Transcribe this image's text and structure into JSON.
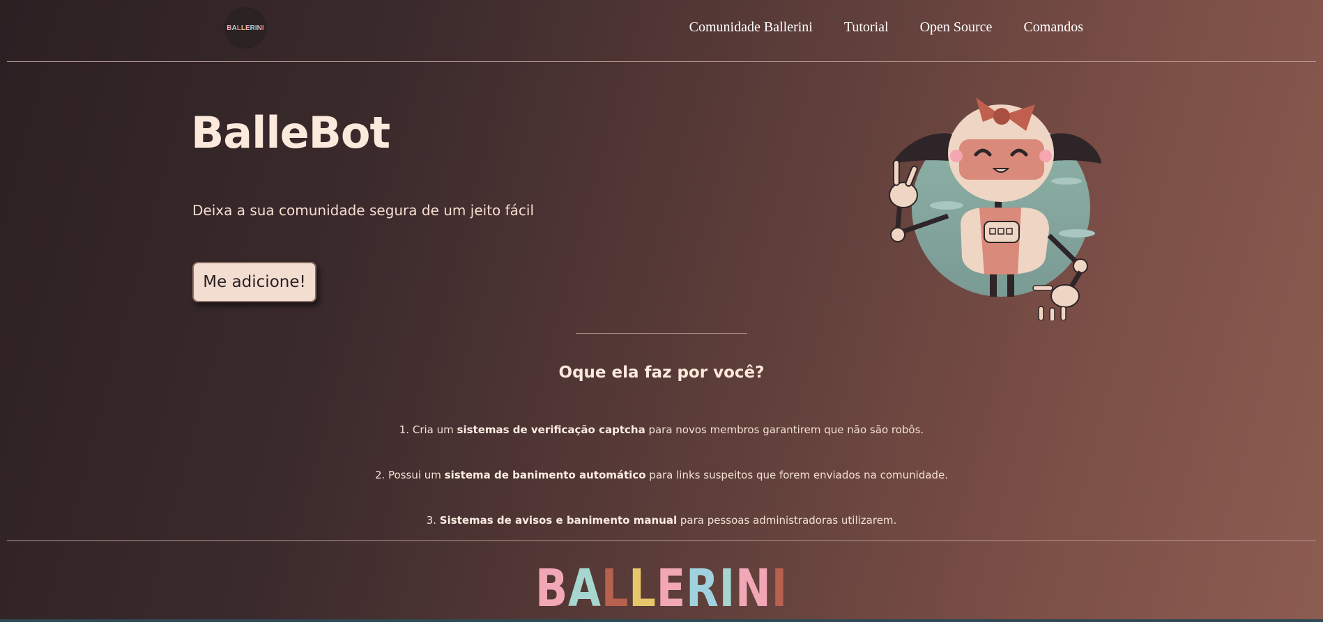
{
  "nav": {
    "logo_text": "BALLERINI",
    "links": [
      {
        "label": "Comunidade Ballerini"
      },
      {
        "label": "Tutorial"
      },
      {
        "label": "Open Source"
      },
      {
        "label": "Comandos"
      }
    ]
  },
  "hero": {
    "title": "BalleBot",
    "subtitle": "Deixa a sua comunidade segura de um jeito fácil",
    "button_label": "Me adicione!"
  },
  "features_section": {
    "title": "Oque ela faz por você?",
    "items": [
      {
        "prefix": "1. Cria um ",
        "bold": "sistemas de verificação captcha",
        "suffix": " para novos membros garantirem que não são robôs."
      },
      {
        "prefix": "2. Possui um ",
        "bold": "sistema de banimento automático",
        "suffix": " para links suspeitos que forem enviados na comunidade."
      },
      {
        "prefix": "3. ",
        "bold": "Sistemas de avisos e banimento manual",
        "suffix": " para pessoas administradoras utilizarem."
      }
    ]
  },
  "footer": {
    "logo_letters": [
      {
        "char": "B",
        "color": "#f2a7b6"
      },
      {
        "char": "A",
        "color": "#a6d6cf"
      },
      {
        "char": "L",
        "color": "#b8614f"
      },
      {
        "char": "L",
        "color": "#e8c76b"
      },
      {
        "char": "E",
        "color": "#f2a7b6"
      },
      {
        "char": "R",
        "color": "#9fd2de"
      },
      {
        "char": "I",
        "color": "#a6d6cf"
      },
      {
        "char": "N",
        "color": "#f2a7b6"
      },
      {
        "char": "I",
        "color": "#b8614f"
      }
    ]
  },
  "colors": {
    "background_dark": "#2c2023",
    "background_light": "#8c5c51",
    "text_cream": "#fbe9dc",
    "button_bg": "#f2ddd0"
  }
}
